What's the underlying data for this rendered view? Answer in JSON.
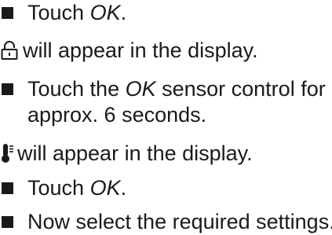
{
  "instructions": {
    "step1": {
      "prefix": "Touch ",
      "keyword": "OK",
      "suffix": "."
    },
    "note1": {
      "icon": "lock-open-icon",
      "text": "will appear in the display."
    },
    "step2": {
      "line1_prefix": "Touch the ",
      "keyword": "OK",
      "line1_suffix": " sensor control for",
      "line2": "approx. 6 seconds."
    },
    "note2": {
      "icon": "thermometer-icon",
      "text": "will appear in the display."
    },
    "step3": {
      "prefix": "Touch ",
      "keyword": "OK",
      "suffix": "."
    },
    "step4": {
      "text": "Now select the required settings."
    }
  },
  "colors": {
    "text": "#1a1a1a",
    "background": "#ffffff"
  }
}
